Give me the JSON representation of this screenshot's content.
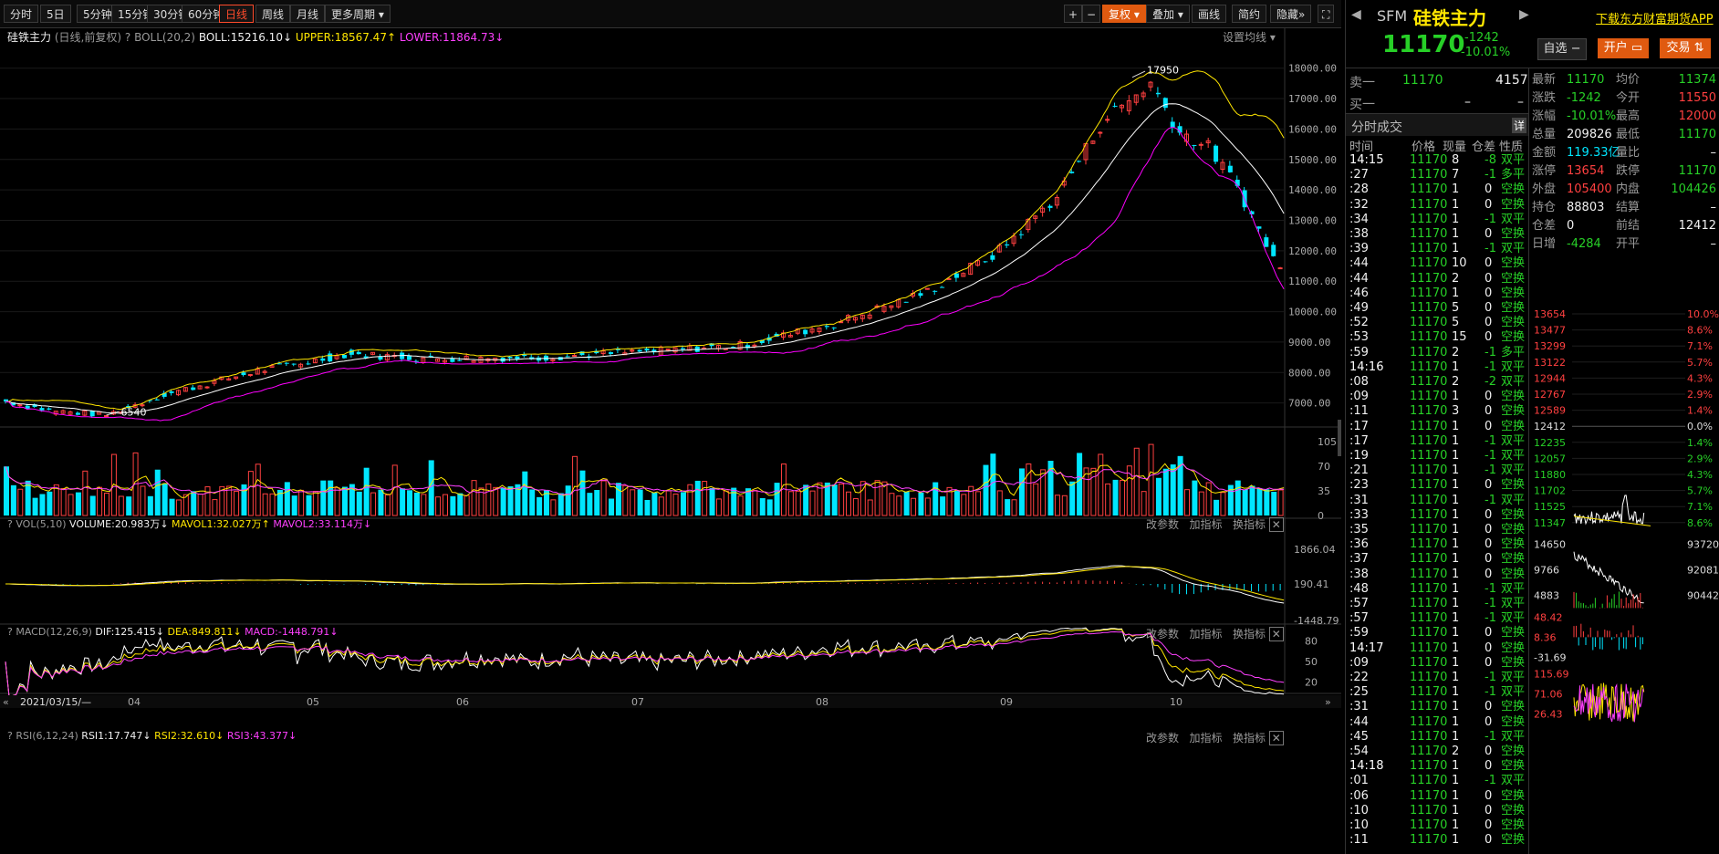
{
  "toolbar": {
    "tabs": [
      "分时",
      "5日",
      "5分钟",
      "15分钟",
      "30分钟",
      "60分钟",
      "日线",
      "周线",
      "月线",
      "更多周期"
    ],
    "right_buttons": [
      "复权",
      "叠加",
      "画线",
      "简约",
      "隐藏"
    ],
    "plus": "+",
    "minus": "−"
  },
  "chart_header": {
    "name": "硅铁主力",
    "mode": "(日线,前复权)",
    "boll_label": "BOLL(20,2)",
    "boll_value": "BOLL:15216.10",
    "upper_value": "UPPER:18567.47",
    "lower_value": "LOWER:11864.73",
    "settings": "设置均线"
  },
  "vol_header": {
    "label": "VOL(5,10)",
    "volume": "VOLUME:20.983万",
    "mavol1": "MAVOL1:32.027万",
    "mavol2": "MAVOL2:33.114万",
    "actions": [
      "改参数",
      "加指标",
      "换指标"
    ]
  },
  "macd_header": {
    "label": "MACD(12,26,9)",
    "dif": "DIF:125.415",
    "dea": "DEA:849.811",
    "macd": "MACD:-1448.791",
    "actions": [
      "改参数",
      "加指标",
      "换指标"
    ]
  },
  "rsi_header": {
    "label": "RSI(6,12,24)",
    "rsi1": "RSI1:17.747",
    "rsi2": "RSI2:32.610",
    "rsi3": "RSI3:43.377",
    "actions": [
      "改参数",
      "加指标",
      "换指标"
    ]
  },
  "price_axis": [
    "18000.00",
    "17000.00",
    "16000.00",
    "15000.00",
    "14000.00",
    "13000.00",
    "12000.00",
    "11000.00",
    "10000.00",
    "9000.00",
    "8000.00",
    "7000.00"
  ],
  "vol_axis": [
    "105",
    "70",
    "35",
    "0"
  ],
  "macd_axis": [
    "1866.04",
    "190.41",
    "-1448.79"
  ],
  "rsi_axis": [
    "80",
    "50",
    "20"
  ],
  "date_axis": {
    "start": "2021/03/15/—",
    "months": [
      "04",
      "05",
      "06",
      "07",
      "08",
      "09",
      "10"
    ]
  },
  "annotations": {
    "high": "17950",
    "low": "6540"
  },
  "colors": {
    "up": "#ff4040",
    "down": "#00e6ff",
    "boll_mid": "#ffffff",
    "boll_upper": "#ffe600",
    "boll_lower": "#ff00ff"
  },
  "chart_data": {
    "type": "candlestick",
    "title": "硅铁主力 (日线,前复权)",
    "ylim": [
      6300,
      18800
    ],
    "monthly_close_approx": [
      {
        "month": "03",
        "close": 6900
      },
      {
        "month": "04",
        "close": 7400
      },
      {
        "month": "05",
        "close": 8000
      },
      {
        "month": "06",
        "close": 8200
      },
      {
        "month": "07",
        "close": 8500
      },
      {
        "month": "08",
        "close": 9500
      },
      {
        "month": "09",
        "close": 15200
      },
      {
        "month": "10",
        "close": 11170
      }
    ],
    "high": 17950,
    "low": 6540
  },
  "quote": {
    "code": "SFM",
    "name": "硅铁主力",
    "price": "11170",
    "change": "-1242",
    "change_pct": "-10.01%",
    "download_app": "下载东方财富期货APP",
    "self_select": "自选",
    "open_account": "开户",
    "trade": "交易",
    "ask_label": "卖一",
    "ask_price": "11170",
    "ask_vol": "4157",
    "bid_label": "买一",
    "bid_price": "–",
    "bid_vol": "–",
    "ticks_title": "分时成交",
    "ticks_detail": "详",
    "tick_headers": [
      "时间",
      "价格",
      "现量",
      "仓差",
      "性质"
    ]
  },
  "stats": [
    [
      "最新",
      "11170",
      "均价",
      "11374"
    ],
    [
      "涨跌",
      "-1242",
      "今开",
      "11550"
    ],
    [
      "涨幅",
      "-10.01%",
      "最高",
      "12000"
    ],
    [
      "总量",
      "209826",
      "最低",
      "11170"
    ],
    [
      "金额",
      "119.33亿",
      "量比",
      "–"
    ],
    [
      "涨停",
      "13654",
      "跌停",
      "11170"
    ],
    [
      "外盘",
      "105400",
      "内盘",
      "104426"
    ],
    [
      "持仓",
      "88803",
      "结算",
      "–"
    ],
    [
      "仓差",
      "0",
      "前结",
      "12412"
    ],
    [
      "日增",
      "-4284",
      "开平",
      "–"
    ]
  ],
  "ticks": [
    [
      "14:15",
      "11170",
      "8",
      "-8",
      "双平"
    ],
    [
      ":27",
      "11170",
      "7",
      "-1",
      "多平"
    ],
    [
      ":28",
      "11170",
      "1",
      "0",
      "空换"
    ],
    [
      ":32",
      "11170",
      "1",
      "0",
      "空换"
    ],
    [
      ":34",
      "11170",
      "1",
      "-1",
      "双平"
    ],
    [
      ":38",
      "11170",
      "1",
      "0",
      "空换"
    ],
    [
      ":39",
      "11170",
      "1",
      "-1",
      "双平"
    ],
    [
      ":44",
      "11170",
      "10",
      "0",
      "空换"
    ],
    [
      ":44",
      "11170",
      "2",
      "0",
      "空换"
    ],
    [
      ":46",
      "11170",
      "1",
      "0",
      "空换"
    ],
    [
      ":49",
      "11170",
      "5",
      "0",
      "空换"
    ],
    [
      ":52",
      "11170",
      "5",
      "0",
      "空换"
    ],
    [
      ":53",
      "11170",
      "15",
      "0",
      "空换"
    ],
    [
      ":59",
      "11170",
      "2",
      "-1",
      "多平"
    ],
    [
      "14:16",
      "11170",
      "1",
      "-1",
      "双平"
    ],
    [
      ":08",
      "11170",
      "2",
      "-2",
      "双平"
    ],
    [
      ":09",
      "11170",
      "1",
      "0",
      "空换"
    ],
    [
      ":11",
      "11170",
      "3",
      "0",
      "空换"
    ],
    [
      ":17",
      "11170",
      "1",
      "0",
      "空换"
    ],
    [
      ":17",
      "11170",
      "1",
      "-1",
      "双平"
    ],
    [
      ":19",
      "11170",
      "1",
      "-1",
      "双平"
    ],
    [
      ":21",
      "11170",
      "1",
      "-1",
      "双平"
    ],
    [
      ":23",
      "11170",
      "1",
      "0",
      "空换"
    ],
    [
      ":31",
      "11170",
      "1",
      "-1",
      "双平"
    ],
    [
      ":33",
      "11170",
      "1",
      "0",
      "空换"
    ],
    [
      ":35",
      "11170",
      "1",
      "0",
      "空换"
    ],
    [
      ":36",
      "11170",
      "1",
      "0",
      "空换"
    ],
    [
      ":37",
      "11170",
      "1",
      "0",
      "空换"
    ],
    [
      ":38",
      "11170",
      "1",
      "0",
      "空换"
    ],
    [
      ":48",
      "11170",
      "1",
      "-1",
      "双平"
    ],
    [
      ":57",
      "11170",
      "1",
      "-1",
      "双平"
    ],
    [
      ":57",
      "11170",
      "1",
      "-1",
      "双平"
    ],
    [
      ":59",
      "11170",
      "1",
      "0",
      "空换"
    ],
    [
      "14:17",
      "11170",
      "1",
      "0",
      "空换"
    ],
    [
      ":09",
      "11170",
      "1",
      "0",
      "空换"
    ],
    [
      ":22",
      "11170",
      "1",
      "-1",
      "双平"
    ],
    [
      ":25",
      "11170",
      "1",
      "-1",
      "双平"
    ],
    [
      ":31",
      "11170",
      "1",
      "0",
      "空换"
    ],
    [
      ":44",
      "11170",
      "1",
      "0",
      "空换"
    ],
    [
      ":45",
      "11170",
      "1",
      "-1",
      "双平"
    ],
    [
      ":54",
      "11170",
      "2",
      "0",
      "空换"
    ],
    [
      "14:18",
      "11170",
      "1",
      "0",
      "空换"
    ],
    [
      ":01",
      "11170",
      "1",
      "-1",
      "双平"
    ],
    [
      ":06",
      "11170",
      "1",
      "0",
      "空换"
    ],
    [
      ":10",
      "11170",
      "1",
      "0",
      "空换"
    ],
    [
      ":10",
      "11170",
      "1",
      "0",
      "空换"
    ],
    [
      ":11",
      "11170",
      "1",
      "0",
      "空换"
    ]
  ],
  "mini_price_left": [
    "13654",
    "13477",
    "13299",
    "13122",
    "12944",
    "12767",
    "12589",
    "12412",
    "12235",
    "12057",
    "11880",
    "11702",
    "11525",
    "11347"
  ],
  "mini_price_right": [
    "10.0%",
    "8.6%",
    "7.1%",
    "5.7%",
    "4.3%",
    "2.9%",
    "1.4%",
    "0.0%",
    "1.4%",
    "2.9%",
    "4.3%",
    "5.7%",
    "7.1%",
    "8.6%"
  ],
  "mini_vol_left": [
    "14650",
    "9766",
    "4883"
  ],
  "mini_vol_right": [
    "93720",
    "92081",
    "90442"
  ],
  "mini_macd": [
    "48.42",
    "8.36",
    "-31.69"
  ],
  "mini_rsi": [
    "115.69",
    "71.06",
    "26.43"
  ]
}
